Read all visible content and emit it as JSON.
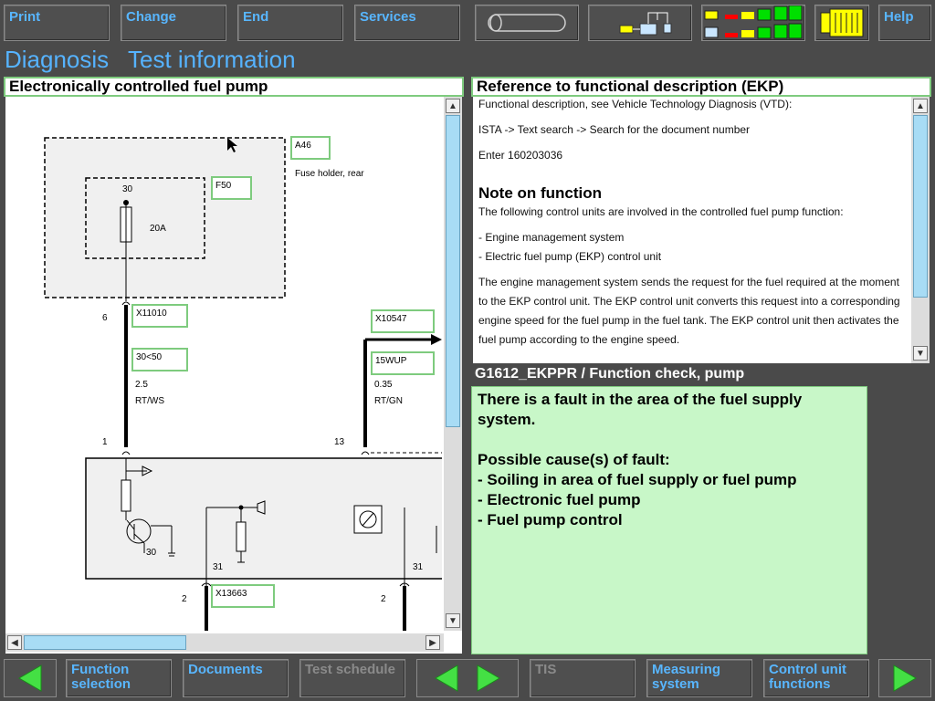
{
  "toolbar": {
    "print": "Print",
    "change": "Change",
    "end": "End",
    "services": "Services",
    "help": "Help"
  },
  "header": {
    "diagnosis": "Diagnosis",
    "test_information": "Test information"
  },
  "left_panel": {
    "title": "Electronically controlled fuel pump",
    "diagram": {
      "a46": "A46",
      "fuse_holder": "Fuse holder, rear",
      "f50": "F50",
      "pin30": "30",
      "fuse_rating": "20A",
      "pin6": "6",
      "x11010": "X11010",
      "wire1_code": "30<50",
      "wire1_size": "2.5",
      "wire1_color": "RT/WS",
      "x10547": "X10547",
      "wire2_code": "15WUP",
      "wire2_size": "0.35",
      "wire2_color": "RT/GN",
      "pin1": "1",
      "pin13": "13",
      "pin30b": "30",
      "pin31a": "31",
      "pin31b": "31",
      "pin2a": "2",
      "pin2b": "2",
      "x13663": "X13663"
    }
  },
  "right_panel": {
    "title": "Reference to functional description (EKP)",
    "lines": [
      "Functional description, see Vehicle Technology Diagnosis (VTD):",
      "ISTA -> Text search -> Search for the document number",
      "Enter 160203036"
    ],
    "note_title": "Note on function",
    "note_intro": "The following control units are involved in the controlled fuel pump function:",
    "list": [
      "- Engine management system",
      "- Electric fuel pump (EKP) control unit"
    ],
    "paragraph": "The engine management system sends the request for the fuel required at the moment to the EKP control unit. The EKP control unit converts this request into a corresponding engine speed for the fuel pump in the fuel tank. The EKP control unit then activates the fuel pump according to the engine speed."
  },
  "check": {
    "title": "G1612_EKPPR / Function check, pump",
    "fault_line": "There is a fault in the area of the fuel supply system.",
    "causes_title": "Possible cause(s) of fault:",
    "causes": [
      "- Soiling in area of fuel supply or fuel pump",
      "- Electronic fuel pump",
      "- Fuel pump control"
    ]
  },
  "bottom_bar": {
    "function_selection": "Function selection",
    "documents": "Documents",
    "test_schedule": "Test schedule",
    "tis": "TIS",
    "measuring_system": "Measuring system",
    "control_unit_functions": "Control unit functions"
  },
  "colors": {
    "accent_blue": "#56b3ff",
    "green_frame": "#7ecb7e",
    "fault_bg": "#c8f7c8",
    "status_green": "#00e000",
    "status_yellow": "#ffff00",
    "status_red": "#ff0000"
  },
  "icons": [
    "battery-icon",
    "network-icon",
    "connection-status-icon",
    "connector-icon",
    "arrow-left-icon",
    "arrow-right-icon"
  ]
}
